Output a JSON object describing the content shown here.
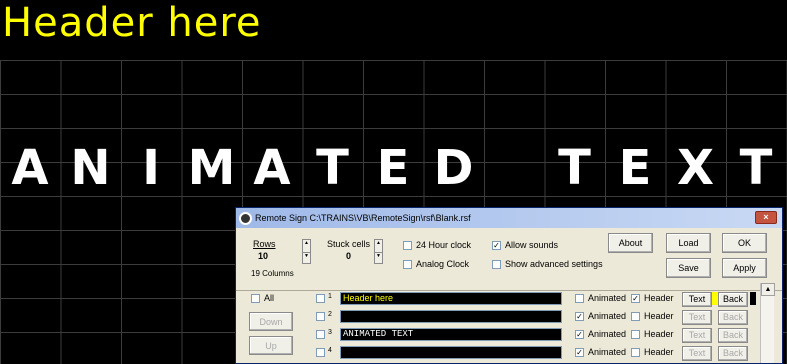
{
  "sign": {
    "header": "Header here",
    "letters": [
      "A",
      "N",
      "I",
      "M",
      "A",
      "T",
      "E",
      "D",
      "",
      "T",
      "E",
      "X",
      "T"
    ]
  },
  "dialog": {
    "title": "Remote Sign C:\\TRAINS\\VB\\RemoteSign\\rsf\\Blank.rsf",
    "close": "×",
    "rows_label": "Rows",
    "rows_value": "10",
    "columns_text": "19 Columns",
    "stuck_label": "Stuck cells",
    "stuck_value": "0",
    "hour24_label": "24 Hour clock",
    "analog_label": "Analog Clock",
    "sounds_label": "Allow sounds",
    "sounds_mark": "✓",
    "advanced_label": "Show advanced settings",
    "about": "About",
    "load": "Load",
    "save": "Save",
    "apply": "Apply",
    "ok": "OK",
    "all_label": "All",
    "down": "Down",
    "up": "Up",
    "scroll_arrow": "▲",
    "rows": [
      {
        "num": "1",
        "text": "Header here",
        "text_color": "#ffff00",
        "animated": "",
        "header": "✓",
        "text_btn": "Text",
        "back_btn": "Back",
        "swatch": "#ffff00",
        "swatch2": "#000000"
      },
      {
        "num": "2",
        "text": "",
        "text_color": "#ffffff",
        "animated": "✓",
        "header": "",
        "text_btn": "Text",
        "back_btn": "Back"
      },
      {
        "num": "3",
        "text": "ANIMATED TEXT",
        "text_color": "#ffffff",
        "animated": "✓",
        "header": "",
        "text_btn": "Text",
        "back_btn": "Back"
      },
      {
        "num": "4",
        "text": "",
        "text_color": "#ffffff",
        "animated": "✓",
        "header": "",
        "text_btn": "Text",
        "back_btn": "Back"
      }
    ],
    "animated_label": "Animated",
    "header_label": "Header"
  }
}
